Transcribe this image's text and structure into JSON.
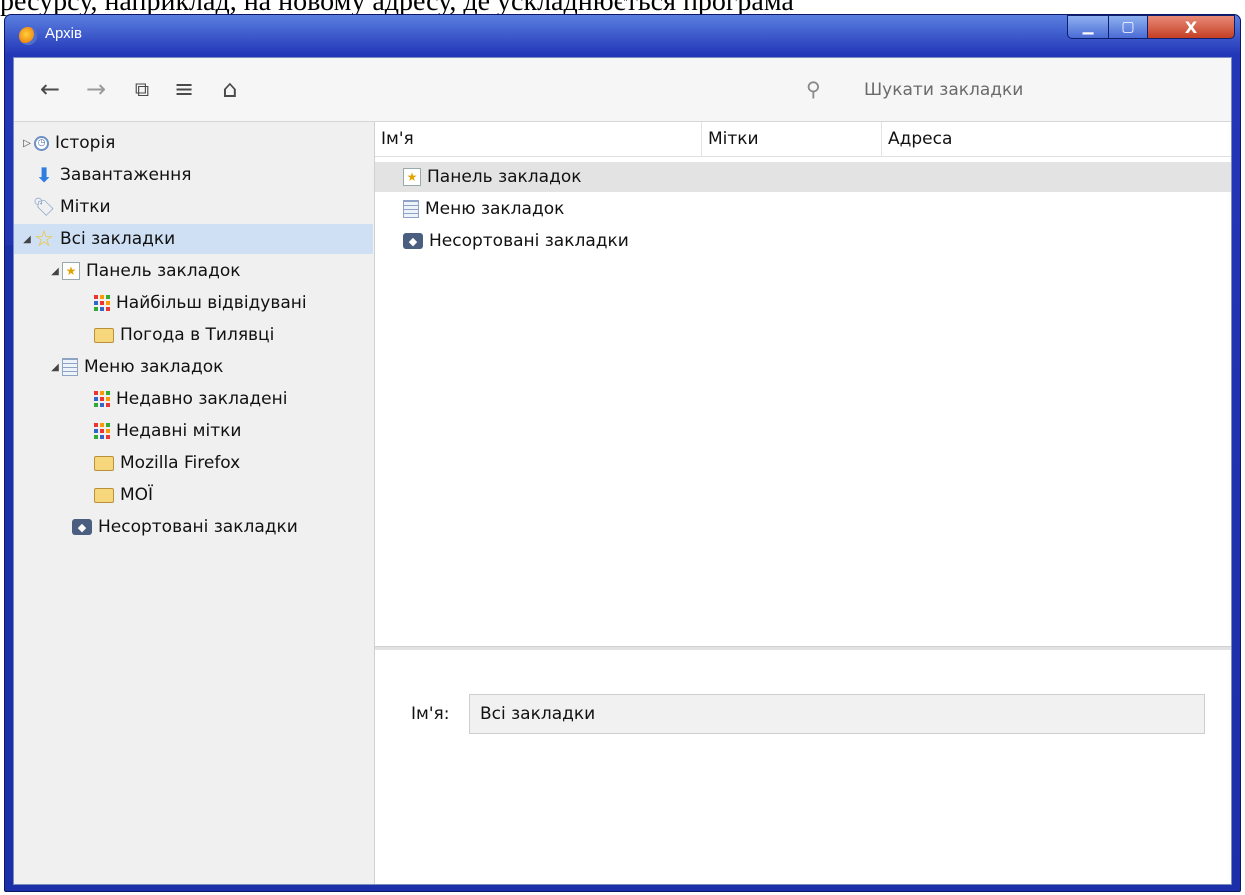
{
  "cut_text": "ресурсу, наприклад, на новому адресу, де ускладнюється програма",
  "window": {
    "title": "Архів",
    "minimize": "▁",
    "maximize": "▢",
    "close": "X"
  },
  "toolbar": {
    "back_icon": "←",
    "forward_icon": "→",
    "organize_icon": "⧉",
    "views_icon": "≡",
    "import_icon": "⌂",
    "search_icon": "🔍",
    "search_placeholder": "Шукати закладки"
  },
  "sidebar": {
    "items": [
      {
        "label": "Історія",
        "icon": "history-icon"
      },
      {
        "label": "Завантаження",
        "icon": "download-icon"
      },
      {
        "label": "Мітки",
        "icon": "tag-icon"
      },
      {
        "label": "Всі закладки",
        "icon": "star-icon"
      },
      {
        "label": "Панель закладок",
        "icon": "bookmarks-toolbar-icon"
      },
      {
        "label": "Найбільш відвідувані",
        "icon": "smart-folder-icon"
      },
      {
        "label": "Погода в Тилявці",
        "icon": "folder-icon"
      },
      {
        "label": "Меню закладок",
        "icon": "bookmarks-menu-icon"
      },
      {
        "label": "Недавно закладені",
        "icon": "smart-folder-icon"
      },
      {
        "label": "Недавні мітки",
        "icon": "smart-folder-icon"
      },
      {
        "label": "Mozilla Firefox",
        "icon": "folder-icon"
      },
      {
        "label": "МОЇ",
        "icon": "folder-icon"
      },
      {
        "label": "Несортовані закладки",
        "icon": "unsorted-bookmarks-icon"
      }
    ]
  },
  "columns": {
    "name": "Ім'я",
    "tags": "Мітки",
    "address": "Адреса"
  },
  "rows": [
    {
      "name": "Панель закладок",
      "icon": "bookmarks-toolbar-icon"
    },
    {
      "name": "Меню закладок",
      "icon": "bookmarks-menu-icon"
    },
    {
      "name": "Несортовані закладки",
      "icon": "unsorted-bookmarks-icon"
    }
  ],
  "details": {
    "name_label": "Ім'я:",
    "name_value": "Всі закладки"
  },
  "colors": {
    "selection": "#cfe0f5",
    "frame": "#1b2fa8"
  }
}
